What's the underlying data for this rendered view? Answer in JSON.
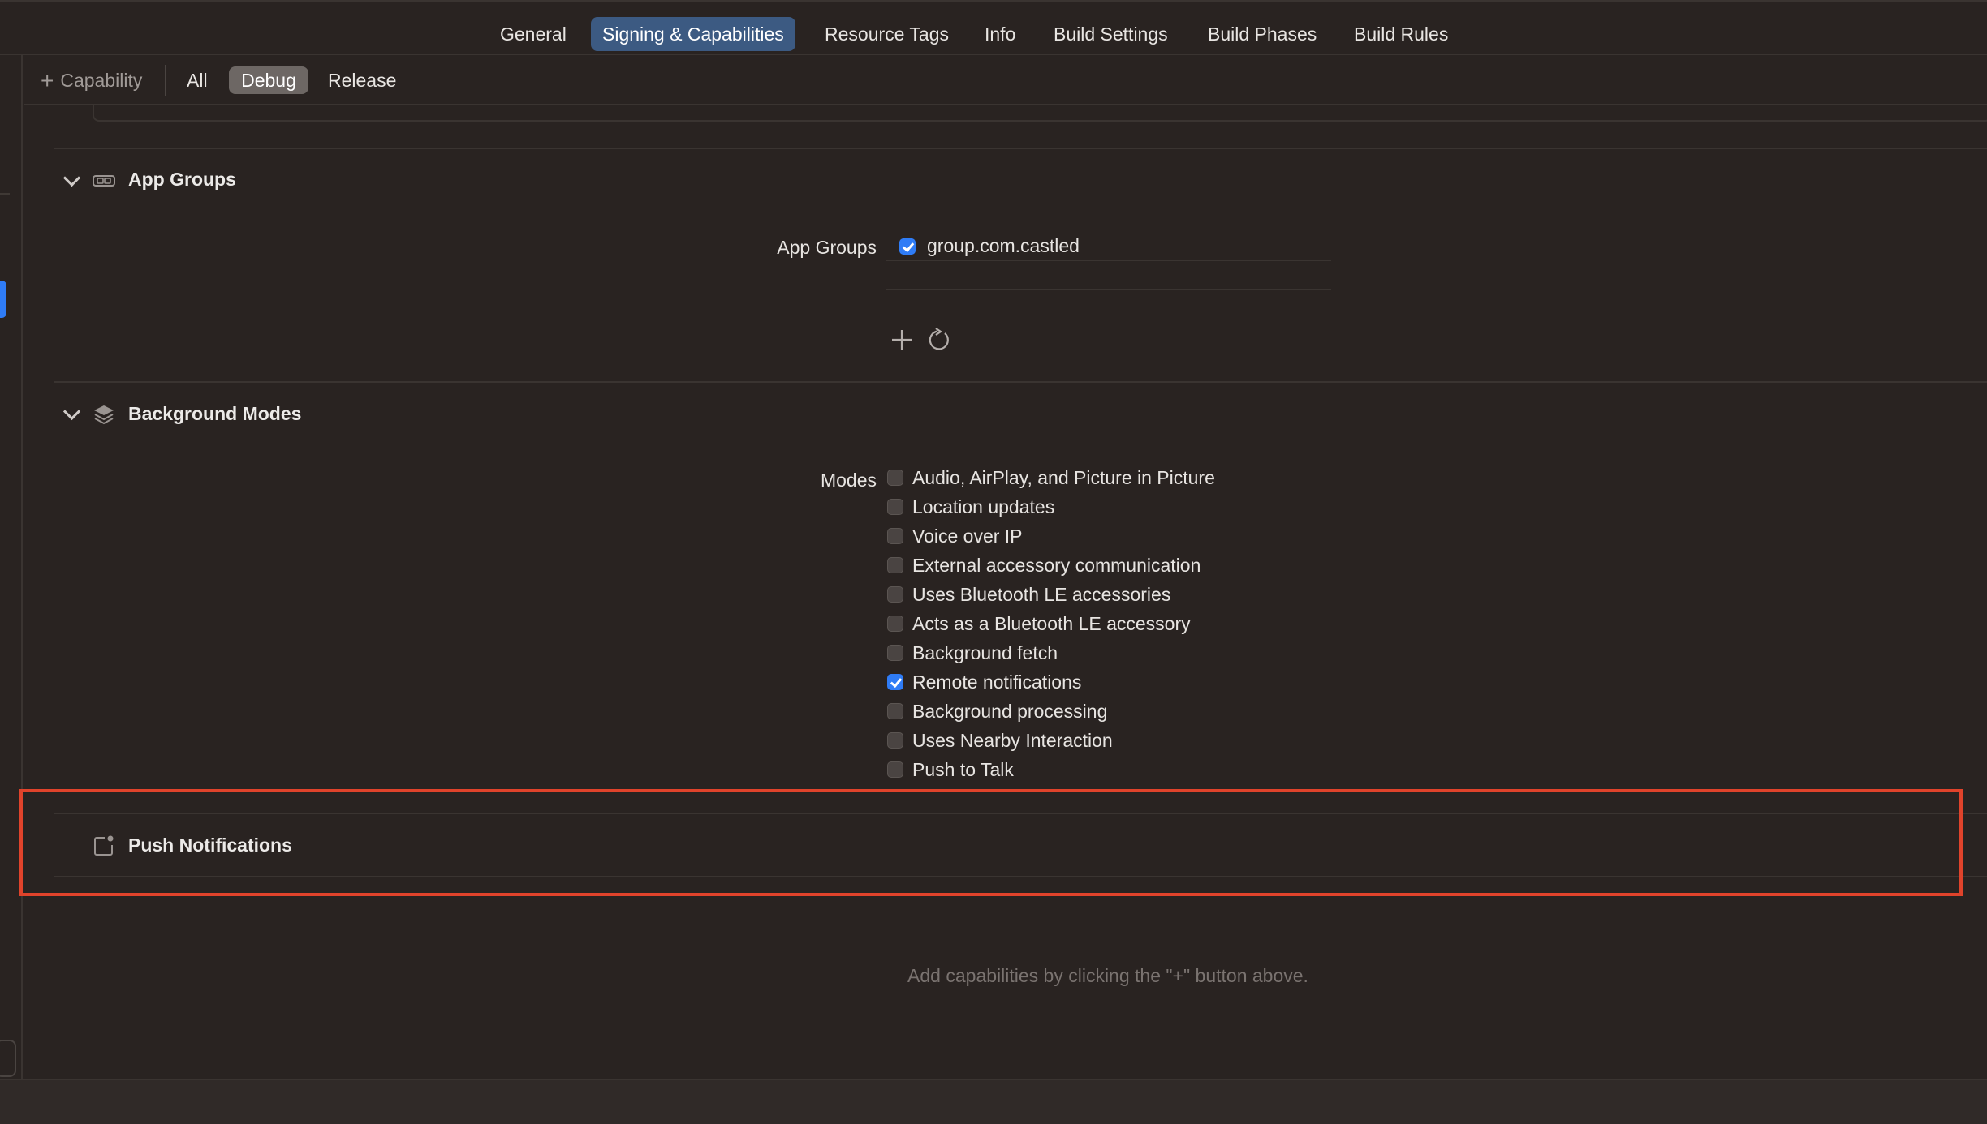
{
  "tabs": [
    {
      "label": "General",
      "active": false
    },
    {
      "label": "Signing & Capabilities",
      "active": true
    },
    {
      "label": "Resource Tags",
      "active": false
    },
    {
      "label": "Info",
      "active": false
    },
    {
      "label": "Build Settings",
      "active": false
    },
    {
      "label": "Build Phases",
      "active": false
    },
    {
      "label": "Build Rules",
      "active": false
    }
  ],
  "filterbar": {
    "capability_label": "Capability",
    "all_label": "All",
    "debug_label": "Debug",
    "release_label": "Release",
    "selected": "Debug"
  },
  "app_groups": {
    "title": "App Groups",
    "row_label": "App Groups",
    "entries": [
      {
        "name": "group.com.castled",
        "checked": true
      }
    ]
  },
  "background_modes": {
    "title": "Background Modes",
    "row_label": "Modes",
    "options": [
      {
        "label": "Audio, AirPlay, and Picture in Picture",
        "checked": false
      },
      {
        "label": "Location updates",
        "checked": false
      },
      {
        "label": "Voice over IP",
        "checked": false
      },
      {
        "label": "External accessory communication",
        "checked": false
      },
      {
        "label": "Uses Bluetooth LE accessories",
        "checked": false
      },
      {
        "label": "Acts as a Bluetooth LE accessory",
        "checked": false
      },
      {
        "label": "Background fetch",
        "checked": false
      },
      {
        "label": "Remote notifications",
        "checked": true
      },
      {
        "label": "Background processing",
        "checked": false
      },
      {
        "label": "Uses Nearby Interaction",
        "checked": false
      },
      {
        "label": "Push to Talk",
        "checked": false
      }
    ]
  },
  "push_notifications": {
    "title": "Push Notifications"
  },
  "hint": "Add capabilities by clicking the \"+\" button above.",
  "colors": {
    "accent": "#2f7cf6",
    "highlight": "#e0432b",
    "background": "#292321"
  },
  "icons": [
    "plus-icon",
    "app-groups-icon",
    "background-modes-icon",
    "push-notifications-icon",
    "add-icon",
    "refresh-icon",
    "chevron-down-icon"
  ]
}
